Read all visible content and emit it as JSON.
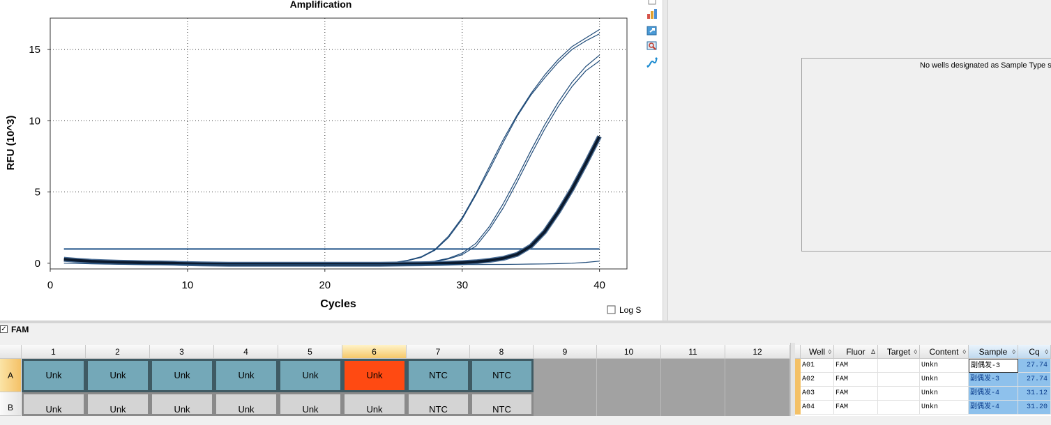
{
  "chart": {
    "title": "Amplification",
    "xlabel": "Cycles",
    "ylabel": "RFU (10^3)",
    "log_scale_label": "Log Scale",
    "log_scale_checked": false
  },
  "chart_data": {
    "type": "line",
    "title": "Amplification",
    "xlabel": "Cycles",
    "ylabel": "RFU (10^3)",
    "xlim": [
      0,
      42
    ],
    "ylim": [
      -0.4,
      17.2
    ],
    "xticks": [
      0,
      10,
      20,
      30,
      40
    ],
    "yticks": [
      0,
      5,
      10,
      15
    ],
    "grid": true,
    "threshold": 1.0,
    "x": [
      1,
      2,
      3,
      4,
      5,
      6,
      7,
      8,
      9,
      10,
      11,
      12,
      13,
      14,
      15,
      16,
      17,
      18,
      19,
      20,
      21,
      22,
      23,
      24,
      25,
      26,
      27,
      28,
      29,
      30,
      31,
      32,
      33,
      34,
      35,
      36,
      37,
      38,
      39,
      40
    ],
    "series": [
      {
        "values": [
          0.25,
          0.18,
          0.12,
          0.08,
          0.05,
          0.03,
          0.02,
          0.01,
          0.0,
          -0.03,
          -0.05,
          -0.06,
          -0.07,
          -0.07,
          -0.07,
          -0.07,
          -0.07,
          -0.07,
          -0.07,
          -0.07,
          -0.07,
          -0.06,
          -0.05,
          -0.02,
          0.05,
          0.2,
          0.45,
          0.95,
          1.9,
          3.2,
          4.9,
          6.8,
          8.7,
          10.4,
          11.9,
          13.2,
          14.3,
          15.2,
          15.8,
          16.4
        ]
      },
      {
        "values": [
          0.2,
          0.14,
          0.1,
          0.07,
          0.05,
          0.03,
          0.02,
          0.01,
          0.0,
          -0.03,
          -0.05,
          -0.06,
          -0.07,
          -0.07,
          -0.07,
          -0.07,
          -0.07,
          -0.07,
          -0.07,
          -0.07,
          -0.07,
          -0.06,
          -0.05,
          -0.02,
          0.04,
          0.17,
          0.4,
          0.9,
          1.8,
          3.1,
          4.8,
          6.6,
          8.5,
          10.3,
          11.8,
          13.0,
          14.1,
          15.0,
          15.6,
          16.1
        ]
      },
      {
        "values": [
          0.22,
          0.16,
          0.11,
          0.07,
          0.05,
          0.03,
          0.02,
          0.01,
          0.0,
          -0.03,
          -0.05,
          -0.06,
          -0.07,
          -0.07,
          -0.07,
          -0.07,
          -0.07,
          -0.07,
          -0.07,
          -0.07,
          -0.07,
          -0.07,
          -0.07,
          -0.06,
          -0.04,
          0.0,
          0.05,
          0.15,
          0.35,
          0.7,
          1.4,
          2.6,
          4.2,
          6.0,
          7.9,
          9.7,
          11.3,
          12.7,
          13.8,
          14.6
        ]
      },
      {
        "values": [
          0.2,
          0.14,
          0.1,
          0.07,
          0.05,
          0.03,
          0.02,
          0.01,
          0.0,
          -0.03,
          -0.05,
          -0.06,
          -0.07,
          -0.07,
          -0.07,
          -0.07,
          -0.07,
          -0.07,
          -0.07,
          -0.07,
          -0.07,
          -0.07,
          -0.07,
          -0.06,
          -0.05,
          -0.01,
          0.04,
          0.12,
          0.3,
          0.6,
          1.2,
          2.4,
          3.9,
          5.7,
          7.6,
          9.4,
          11.0,
          12.4,
          13.5,
          14.2
        ]
      },
      {
        "values": [
          0.28,
          0.2,
          0.14,
          0.1,
          0.07,
          0.05,
          0.03,
          0.02,
          0.0,
          -0.03,
          -0.05,
          -0.06,
          -0.07,
          -0.07,
          -0.07,
          -0.07,
          -0.07,
          -0.07,
          -0.07,
          -0.07,
          -0.07,
          -0.07,
          -0.07,
          -0.07,
          -0.06,
          -0.05,
          -0.04,
          -0.02,
          0.0,
          0.04,
          0.1,
          0.2,
          0.35,
          0.62,
          1.2,
          2.2,
          3.6,
          5.2,
          7.0,
          8.9
        ],
        "bold": true
      },
      {
        "values": [
          0.0,
          -0.02,
          -0.04,
          -0.06,
          -0.07,
          -0.08,
          -0.08,
          -0.09,
          -0.09,
          -0.09,
          -0.09,
          -0.09,
          -0.09,
          -0.09,
          -0.09,
          -0.09,
          -0.09,
          -0.09,
          -0.09,
          -0.09,
          -0.09,
          -0.09,
          -0.09,
          -0.09,
          -0.09,
          -0.09,
          -0.09,
          -0.09,
          -0.09,
          -0.09,
          -0.09,
          -0.08,
          -0.08,
          -0.07,
          -0.06,
          -0.05,
          -0.03,
          0.0,
          0.06,
          0.15
        ]
      }
    ]
  },
  "toolbar": {
    "icons": [
      "copy-icon",
      "chart-settings-icon",
      "export-icon",
      "zoom-icon",
      "curve-icon"
    ]
  },
  "std_curve": {
    "message": "No wells designated as Sample Type sta"
  },
  "fluor": {
    "label": "FAM",
    "checked": true,
    "checkmark": "✓"
  },
  "plate": {
    "columns": [
      "1",
      "2",
      "3",
      "4",
      "5",
      "6",
      "7",
      "8",
      "9",
      "10",
      "11",
      "12"
    ],
    "selected_column": "6",
    "rows": [
      {
        "label": "A",
        "selected": true,
        "wells": [
          "Unk",
          "Unk",
          "Unk",
          "Unk",
          "Unk",
          "Unk",
          "NTC",
          "NTC",
          "",
          "",
          "",
          ""
        ]
      },
      {
        "label": "B",
        "selected": false,
        "wells": [
          "Unk",
          "Unk",
          "Unk",
          "Unk",
          "Unk",
          "Unk",
          "NTC",
          "NTC",
          "",
          "",
          "",
          ""
        ]
      }
    ]
  },
  "table": {
    "headers": [
      {
        "label": "Well",
        "sort": "◊"
      },
      {
        "label": "Fluor",
        "sort": "Δ"
      },
      {
        "label": "Target",
        "sort": "◊"
      },
      {
        "label": "Content",
        "sort": "◊"
      },
      {
        "label": "Sample",
        "sort": "◊"
      },
      {
        "label": "Cq",
        "sort": "◊"
      }
    ],
    "rows": [
      {
        "well": "A01",
        "fluor": "FAM",
        "target": "",
        "content": "Unkn",
        "sample": "副偶发-3",
        "cq": "27.74"
      },
      {
        "well": "A02",
        "fluor": "FAM",
        "target": "",
        "content": "Unkn",
        "sample": "副偶发-3",
        "cq": "27.74"
      },
      {
        "well": "A03",
        "fluor": "FAM",
        "target": "",
        "content": "Unkn",
        "sample": "副偶发-4",
        "cq": "31.12"
      },
      {
        "well": "A04",
        "fluor": "FAM",
        "target": "",
        "content": "Unkn",
        "sample": "副偶发-4",
        "cq": "31.20"
      }
    ]
  },
  "colors": {
    "curve": "#1e4a78",
    "curve_bold": "#0b1a2e",
    "threshold": "#1c4f86",
    "well_unk": "#74a8b8",
    "well_selected": "#ff4a12",
    "sample_highlight": "#8ec1ec"
  }
}
